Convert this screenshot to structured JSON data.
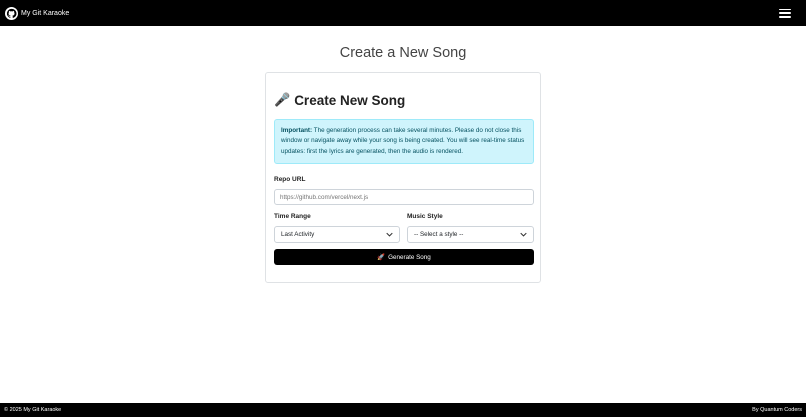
{
  "navbar": {
    "brand": "My Git Karaoke",
    "logo_icon": "github-icon",
    "menu_icon": "hamburger-menu-icon"
  },
  "page": {
    "title": "Create a New Song"
  },
  "card": {
    "title_icon": "🎤",
    "title": "Create New Song",
    "alert": {
      "strong": "Important:",
      "text": "The generation process can take several minutes. Please do not close this window or navigate away while your song is being created. You will see real-time status updates: first the lyrics are generated, then the audio is rendered."
    },
    "repo_url": {
      "label": "Repo URL",
      "placeholder": "https://github.com/vercel/next.js",
      "value": ""
    },
    "time_range": {
      "label": "Time Range",
      "selected": "Last Activity"
    },
    "music_style": {
      "label": "Music Style",
      "selected": "-- Select a style --"
    },
    "generate_button": {
      "icon": "🚀",
      "label": "Generate Song"
    }
  },
  "footer": {
    "left": "© 2025 My Git Karaoke",
    "right": "By Quantum Coders"
  },
  "colors": {
    "navbar": "#000000",
    "alert_bg": "#cff4fc",
    "alert_text": "#055160",
    "button": "#000000"
  }
}
